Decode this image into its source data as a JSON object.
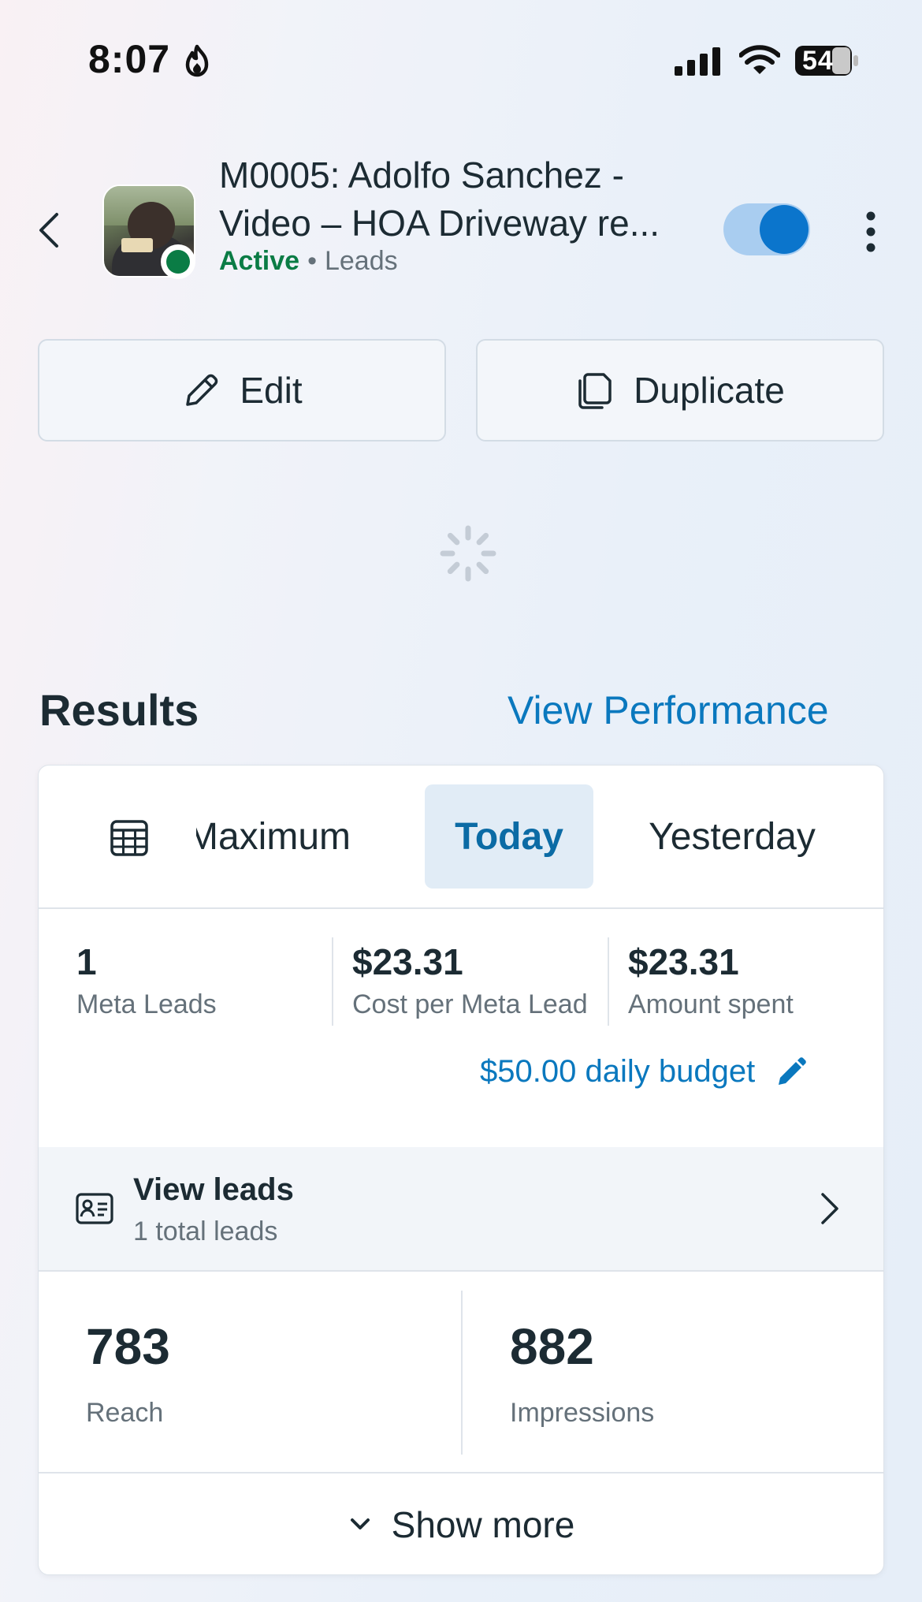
{
  "status_bar": {
    "time": "8:07",
    "battery": "54",
    "icons": [
      "fire-icon",
      "signal-icon",
      "wifi-icon",
      "battery-icon"
    ]
  },
  "header": {
    "title_line1": "M0005: Adolfo Sanchez -",
    "title_line2": "Video – HOA Driveway re...",
    "status": "Active",
    "separator": "•",
    "objective": "Leads",
    "toggle_on": true,
    "colors": {
      "active": "#0a7c45",
      "accent": "#0b75cc"
    }
  },
  "actions": {
    "edit_label": "Edit",
    "duplicate_label": "Duplicate"
  },
  "results": {
    "title": "Results",
    "view_performance": "View Performance",
    "tabs": {
      "maximum": "Maximum",
      "today": "Today",
      "yesterday": "Yesterday",
      "selected": "Today"
    },
    "metrics": [
      {
        "value": "1",
        "label": "Meta Leads"
      },
      {
        "value": "$23.31",
        "label": "Cost per Meta Lead"
      },
      {
        "value": "$23.31",
        "label": "Amount spent"
      }
    ],
    "budget": "$50.00 daily budget",
    "view_leads": {
      "title": "View leads",
      "subtitle": "1 total leads"
    },
    "stats": [
      {
        "value": "783",
        "label": "Reach"
      },
      {
        "value": "882",
        "label": "Impressions"
      }
    ],
    "show_more": "Show more"
  }
}
